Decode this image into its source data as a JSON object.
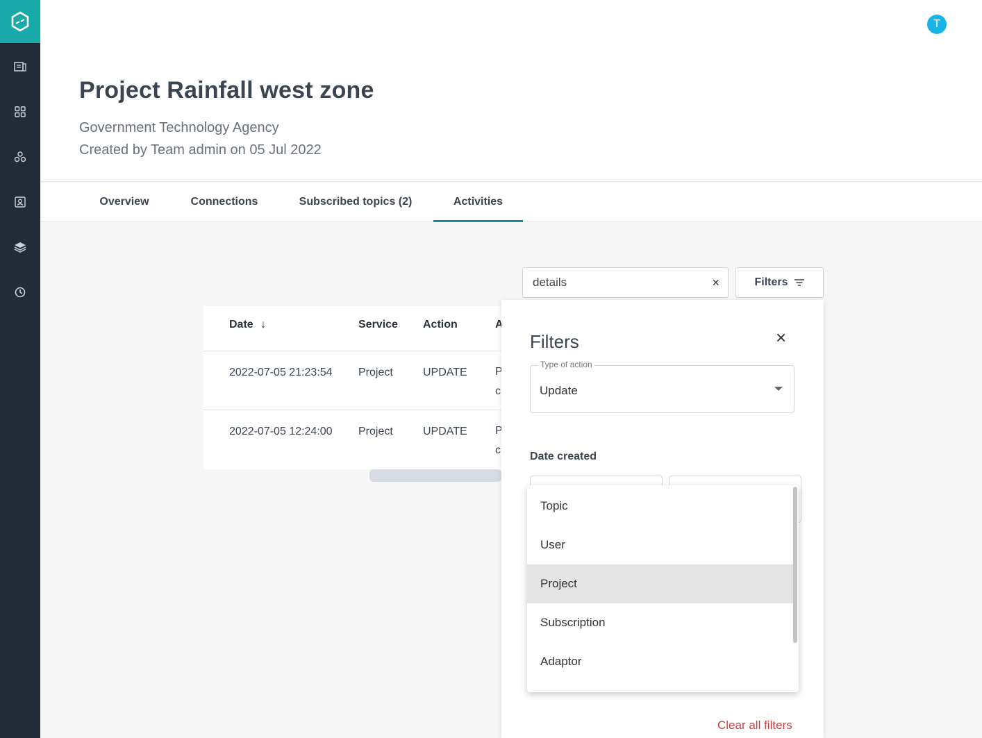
{
  "sidebar": {
    "icons": [
      "logo-icon",
      "datasets-icon",
      "apps-grid-icon",
      "network-icon",
      "contact-card-icon",
      "layers-icon",
      "clock-icon"
    ]
  },
  "header": {
    "avatar_initial": "T",
    "title": "Project Rainfall west zone",
    "agency": "Government Technology Agency",
    "created": "Created by Team admin on 05 Jul 2022"
  },
  "tabs": [
    {
      "label": "Overview"
    },
    {
      "label": "Connections"
    },
    {
      "label": "Subscribed topics (2)"
    },
    {
      "label": "Activities",
      "active": true
    }
  ],
  "search": {
    "value": "details",
    "clear_glyph": "×"
  },
  "filters_button": {
    "label": "Filters"
  },
  "table": {
    "columns": [
      "Date",
      "Service",
      "Action",
      "A"
    ],
    "sort_glyph": "↓",
    "rows": [
      {
        "date": "2022-07-05 21:23:54",
        "service": "Project",
        "action": "UPDATE",
        "trunc1": "P",
        "trunc2": "c"
      },
      {
        "date": "2022-07-05 12:24:00",
        "service": "Project",
        "action": "UPDATE",
        "trunc1": "P",
        "trunc2": "c"
      }
    ]
  },
  "filter_panel": {
    "title": "Filters",
    "close_glyph": "×",
    "type_of_action_label": "Type of action",
    "type_of_action_value": "Update",
    "date_created_label": "Date created",
    "clear_all_label": "Clear all filters"
  },
  "dropdown": {
    "options": [
      "Topic",
      "User",
      "Project",
      "Subscription",
      "Adaptor"
    ],
    "selected": "Project"
  },
  "colors": {
    "sidebar_bg": "#232b36",
    "brand_teal": "#1aa9a9",
    "tab_underline": "#1a8a9a",
    "avatar": "#18b5e6",
    "clear_filters_red": "#d23b3b"
  }
}
